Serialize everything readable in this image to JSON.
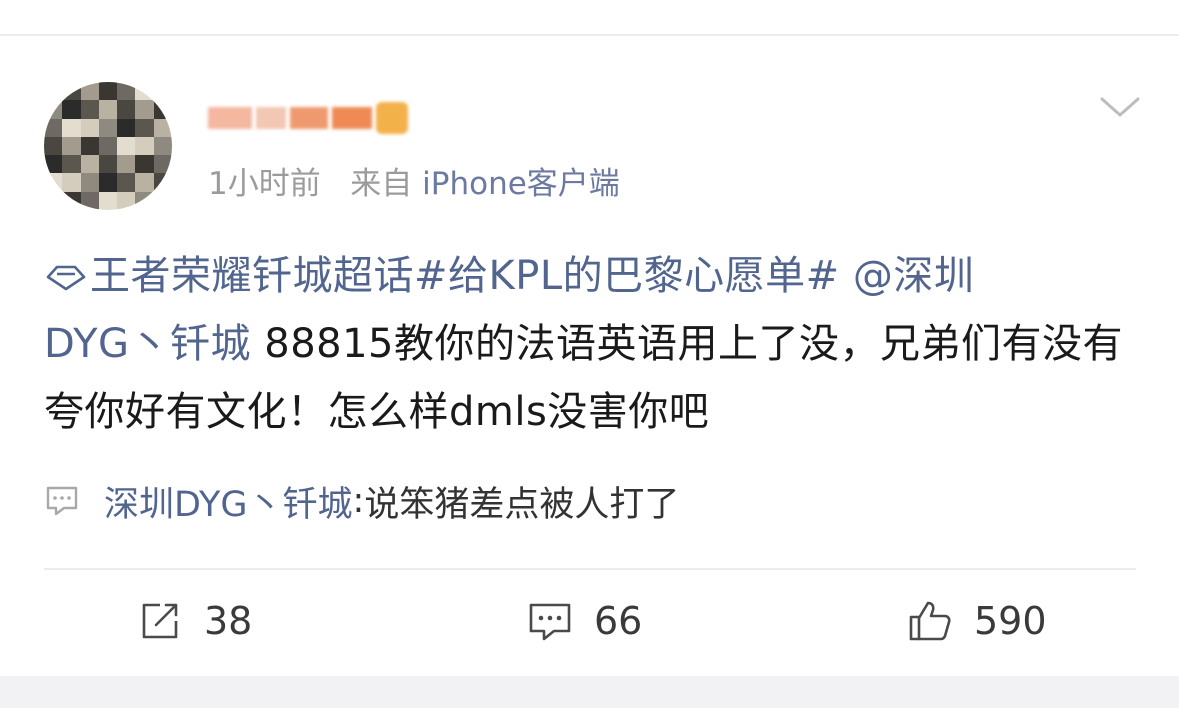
{
  "post": {
    "username": "",
    "time": "1小时前",
    "source_prefix": "来自",
    "source_device": "iPhone客户端",
    "topic_link": "王者荣耀钎城超话",
    "hashtag": "#给KPL的巴黎心愿单#",
    "mention_line1": "@深圳",
    "mention_line2": "DYG丶钎城",
    "text": " 88815教你的法语英语用上了没，兄弟们有没有夸你好有文化！怎么样dmls没害你吧"
  },
  "comment_preview": {
    "author": "深圳DYG丶钎城",
    "separator": ": ",
    "text": "说笨猪差点被人打了"
  },
  "actions": {
    "repost_count": "38",
    "comment_count": "66",
    "like_count": "590"
  },
  "icons": {
    "topic": "diamond-topic-icon",
    "more": "chevron-down-icon",
    "comment_preview": "comment-bubble-icon",
    "repost": "repost-icon",
    "comment": "comment-icon",
    "like": "thumbs-up-icon"
  },
  "colors": {
    "link": "#52658f",
    "meta": "#9b9b9b",
    "text": "#1a1a1a"
  }
}
